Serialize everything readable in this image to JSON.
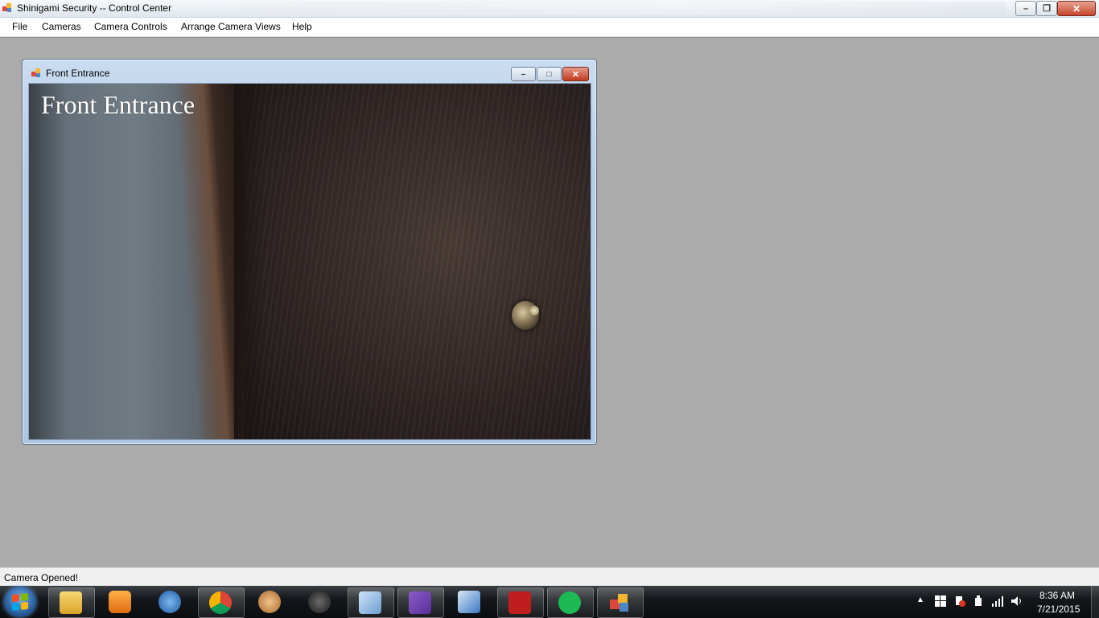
{
  "window": {
    "title": "Shinigami Security -- Control Center",
    "minimize_glyph": "–",
    "maximize_glyph": "❐",
    "close_glyph": "✕"
  },
  "menu": {
    "file": "File",
    "cameras": "Cameras",
    "camera_controls": "Camera Controls",
    "arrange_camera_views": "Arrange Camera Views",
    "help": "Help"
  },
  "camera_window": {
    "title": "Front Entrance",
    "overlay_label": "Front Entrance",
    "minimize_glyph": "–",
    "maximize_glyph": "□",
    "close_glyph": "✕"
  },
  "status": {
    "text": "Camera Opened!"
  },
  "taskbar": {
    "apps": [
      "windows-explorer-icon",
      "media-player-icon",
      "thunderbird-icon",
      "chrome-icon",
      "monkey-app-icon",
      "gpu-app-icon",
      "virtualbox-icon",
      "visual-studio-icon",
      "remote-desktop-icon",
      "filezilla-icon",
      "spotify-icon",
      "shinigami-app-icon"
    ],
    "tray_arrow": "▲",
    "time": "8:36 AM",
    "date": "7/21/2015"
  },
  "colors": {
    "workspace": "#ababab",
    "taskbar": "#14171b",
    "close_button": "#c8452d",
    "spotify": "#1db954",
    "filezilla": "#bf1e1e",
    "visual_studio": "#6a3ea1"
  }
}
